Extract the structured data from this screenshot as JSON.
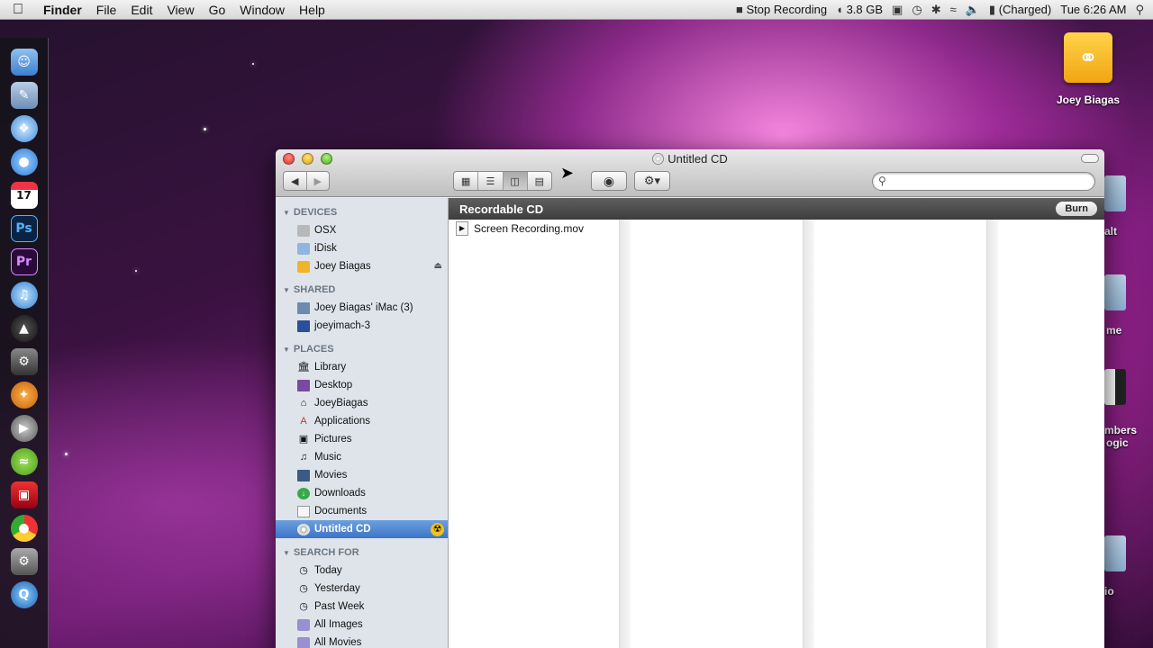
{
  "menubar": {
    "apple_icon": "apple-logo-icon",
    "items": [
      "Finder",
      "File",
      "Edit",
      "View",
      "Go",
      "Window",
      "Help"
    ],
    "status": {
      "stop_recording": "Stop Recording",
      "memory": "3.8 GB",
      "battery": "(Charged)",
      "clock": "Tue 6:26 AM"
    }
  },
  "desktop": {
    "drive_label": "Joey Biagas",
    "peek_labels": [
      "alt",
      "me",
      "mbers",
      "ogic",
      "io"
    ]
  },
  "window": {
    "title": "Untitled CD",
    "search_placeholder": "",
    "path_title": "Recordable CD",
    "burn_button": "Burn",
    "files": [
      "Screen Recording.mov"
    ]
  },
  "sidebar": {
    "devices": {
      "header": "DEVICES",
      "items": [
        "OSX",
        "iDisk",
        "Joey Biagas"
      ]
    },
    "shared": {
      "header": "SHARED",
      "items": [
        "Joey Biagas' iMac (3)",
        "joeyimach-3"
      ]
    },
    "places": {
      "header": "PLACES",
      "items": [
        "Library",
        "Desktop",
        "JoeyBiagas",
        "Applications",
        "Pictures",
        "Music",
        "Movies",
        "Downloads",
        "Documents",
        "Untitled CD"
      ]
    },
    "search_for": {
      "header": "SEARCH FOR",
      "items": [
        "Today",
        "Yesterday",
        "Past Week",
        "All Images",
        "All Movies"
      ]
    }
  },
  "colors": {
    "selection": "#3d74c6",
    "sidebar_bg": "#dee4ea",
    "pathbar_bg": "#4a4a4a"
  }
}
